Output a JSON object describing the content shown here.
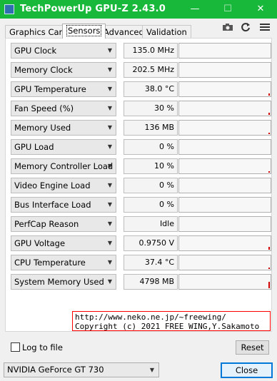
{
  "window": {
    "title": "TechPowerUp GPU-Z 2.43.0",
    "minimize": "—",
    "maximize": "☐",
    "close": "✕"
  },
  "tabs": [
    "Graphics Card",
    "Sensors",
    "Advanced",
    "Validation"
  ],
  "active_tab": "Sensors",
  "toolbar": {
    "camera_icon": "camera-icon",
    "refresh_icon": "refresh-icon",
    "menu_icon": "menu-icon"
  },
  "sensors": [
    {
      "label": "GPU Clock",
      "value": "135.0 MHz",
      "graph_level": 0
    },
    {
      "label": "Memory Clock",
      "value": "202.5 MHz",
      "graph_level": 0
    },
    {
      "label": "GPU Temperature",
      "value": "38.0 °C",
      "graph_level": 0.15
    },
    {
      "label": "Fan Speed (%)",
      "value": "30 %",
      "graph_level": 0.15
    },
    {
      "label": "Memory Used",
      "value": "136 MB",
      "graph_level": 0.1
    },
    {
      "label": "GPU Load",
      "value": "0 %",
      "graph_level": 0
    },
    {
      "label": "Memory Controller Load",
      "value": "10 %",
      "graph_level": 0.1
    },
    {
      "label": "Video Engine Load",
      "value": "0 %",
      "graph_level": 0
    },
    {
      "label": "Bus Interface Load",
      "value": "0 %",
      "graph_level": 0
    },
    {
      "label": "PerfCap Reason",
      "value": "Idle",
      "graph_level": 0
    },
    {
      "label": "GPU Voltage",
      "value": "0.9750 V",
      "graph_level": 0.2
    },
    {
      "label": "CPU Temperature",
      "value": "37.4 °C",
      "graph_level": 0.1
    },
    {
      "label": "System Memory Used",
      "value": "4798 MB",
      "graph_level": 0.45
    }
  ],
  "credit": {
    "line1": "http://www.neko.ne.jp/~freewing/",
    "line2": "Copyright (c) 2021 FREE WING,Y.Sakamoto"
  },
  "log_to_file": {
    "label": "Log to file",
    "checked": false
  },
  "reset_label": "Reset",
  "gpu_select": "NVIDIA GeForce GT 730",
  "close_label": "Close",
  "colors": {
    "titlebar": "#18b83a",
    "graph_bar": "#d00000",
    "credit_border": "#ff0000",
    "focus": "#0078d7"
  }
}
